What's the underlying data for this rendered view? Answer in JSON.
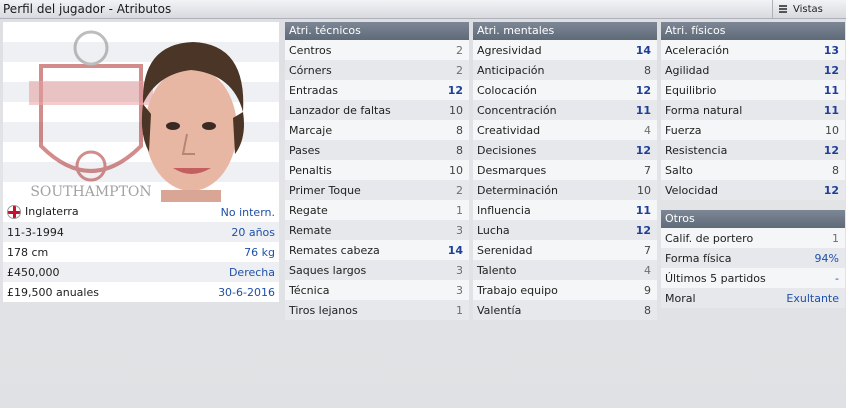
{
  "window": {
    "title": "Perfil del jugador - Atributos",
    "views_label": "Vistas"
  },
  "profile": {
    "nationality": "Inglaterra",
    "international": "No intern.",
    "birth_date": "11-3-1994",
    "age": "20 años",
    "height": "178 cm",
    "weight": "76 kg",
    "value": "£450,000",
    "foot": "Derecha",
    "wage": "£19,500 anuales",
    "contract_end": "30-6-2016"
  },
  "technical": {
    "header": "Atri. técnicos",
    "items": [
      {
        "label": "Centros",
        "value": "2"
      },
      {
        "label": "Córners",
        "value": "2"
      },
      {
        "label": "Entradas",
        "value": "12"
      },
      {
        "label": "Lanzador de faltas",
        "value": "10"
      },
      {
        "label": "Marcaje",
        "value": "8"
      },
      {
        "label": "Pases",
        "value": "8"
      },
      {
        "label": "Penaltis",
        "value": "10"
      },
      {
        "label": "Primer Toque",
        "value": "2"
      },
      {
        "label": "Regate",
        "value": "1"
      },
      {
        "label": "Remate",
        "value": "3"
      },
      {
        "label": "Remates cabeza",
        "value": "14"
      },
      {
        "label": "Saques largos",
        "value": "3"
      },
      {
        "label": "Técnica",
        "value": "3"
      },
      {
        "label": "Tiros lejanos",
        "value": "1"
      }
    ]
  },
  "mental": {
    "header": "Atri. mentales",
    "items": [
      {
        "label": "Agresividad",
        "value": "14"
      },
      {
        "label": "Anticipación",
        "value": "8"
      },
      {
        "label": "Colocación",
        "value": "12"
      },
      {
        "label": "Concentración",
        "value": "11"
      },
      {
        "label": "Creatividad",
        "value": "4"
      },
      {
        "label": "Decisiones",
        "value": "12"
      },
      {
        "label": "Desmarques",
        "value": "7"
      },
      {
        "label": "Determinación",
        "value": "10"
      },
      {
        "label": "Influencia",
        "value": "11"
      },
      {
        "label": "Lucha",
        "value": "12"
      },
      {
        "label": "Serenidad",
        "value": "7"
      },
      {
        "label": "Talento",
        "value": "4"
      },
      {
        "label": "Trabajo equipo",
        "value": "9"
      },
      {
        "label": "Valentía",
        "value": "8"
      }
    ]
  },
  "physical": {
    "header": "Atri. físicos",
    "items": [
      {
        "label": "Aceleración",
        "value": "13"
      },
      {
        "label": "Agilidad",
        "value": "12"
      },
      {
        "label": "Equilibrio",
        "value": "11"
      },
      {
        "label": "Forma natural",
        "value": "11"
      },
      {
        "label": "Fuerza",
        "value": "10"
      },
      {
        "label": "Resistencia",
        "value": "12"
      },
      {
        "label": "Salto",
        "value": "8"
      },
      {
        "label": "Velocidad",
        "value": "12"
      }
    ]
  },
  "other": {
    "header": "Otros",
    "items": [
      {
        "label": "Calif. de portero",
        "value": "1"
      },
      {
        "label": "Forma física",
        "value": "94%"
      },
      {
        "label": "Últimos 5 partidos",
        "value": "-"
      },
      {
        "label": "Moral",
        "value": "Exultante"
      }
    ]
  },
  "club_crest_text": "SOUTHAMPTON",
  "colors": {
    "accent_value": "#1e3f95",
    "header_bg": "#6b7584"
  }
}
